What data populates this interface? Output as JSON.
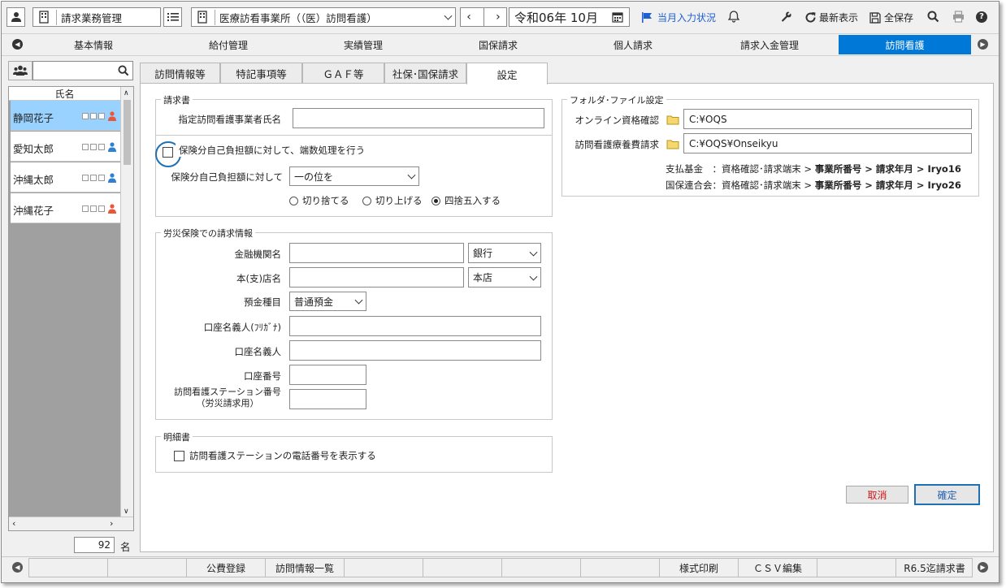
{
  "header": {
    "app_title": "請求業務管理",
    "facility": "医療訪看事業所（（医）訪問看護）",
    "date": "令和06年 10月",
    "monthly_status": "当月入力状況",
    "refresh": "最新表示",
    "save_all": "全保存"
  },
  "nav_tabs": [
    "基本情報",
    "給付管理",
    "実績管理",
    "国保請求",
    "個人請求",
    "請求入金管理",
    "訪問看護"
  ],
  "sub_tabs": [
    "訪問情報等",
    "特記事項等",
    "ＧＡＦ等",
    "社保･国保請求",
    "設定"
  ],
  "patients": {
    "header": "氏名",
    "count": "92",
    "count_unit": "名",
    "items": [
      {
        "name": "静岡花子",
        "gender": "female",
        "selected": true
      },
      {
        "name": "愛知太郎",
        "gender": "male",
        "selected": false
      },
      {
        "name": "沖縄太郎",
        "gender": "male",
        "selected": false
      },
      {
        "name": "沖縄花子",
        "gender": "female",
        "selected": false
      }
    ]
  },
  "invoice": {
    "title": "請求書",
    "provider_name_label": "指定訪問看護事業者氏名",
    "provider_name_value": "",
    "rounding_checkbox_label": "保険分自己負担額に対して、端数処理を行う",
    "rounding_target_label": "保険分自己負担額に対して",
    "rounding_digit": "一の位を",
    "radio_truncate": "切り捨てる",
    "radio_roundup": "切り上げる",
    "radio_round": "四捨五入する"
  },
  "rosai": {
    "title": "労災保険での請求情報",
    "bank_label": "金融機関名",
    "bank_type": "銀行",
    "branch_label": "本(支)店名",
    "branch_type": "本店",
    "deposit_type_label": "預金種目",
    "deposit_type": "普通預金",
    "holder_kana_label": "口座名義人(ﾌﾘｶﾞﾅ)",
    "holder_label": "口座名義人",
    "account_no_label": "口座番号",
    "station_no_label_1": "訪問看護ステーション番号",
    "station_no_label_2": "（労災請求用）"
  },
  "statement": {
    "title": "明細書",
    "show_phone_label": "訪問看護ステーションの電話番号を表示する"
  },
  "folder": {
    "title": "フォルダ･ファイル設定",
    "online_label": "オンライン資格確認",
    "online_path": "C:¥OQS",
    "ryoyo_label": "訪問看護療養費請求",
    "ryoyo_path": "C:¥OQS¥Onseikyu",
    "note1_prefix": "支払基金　：資格確認･請求端末 > ",
    "note1_bold": "事業所番号 > 請求年月 > Iryo16",
    "note2_prefix": "国保連合会：資格確認･請求端末 > ",
    "note2_bold": "事業所番号 > 請求年月 > Iryo26"
  },
  "actions": {
    "cancel": "取消",
    "confirm": "確定"
  },
  "footer": [
    "",
    "",
    "公費登録",
    "訪問情報一覧",
    "",
    "",
    "",
    "",
    "様式印刷",
    "ＣＳＶ編集",
    "",
    "R6.5迄請求書"
  ],
  "colors": {
    "active_tab": "#0078d7",
    "focus_ring": "#1f6fb3",
    "selected_row": "#99d1ff",
    "female": "#e8573a",
    "male": "#2f80d1",
    "cancel_text": "#d11515",
    "confirm_text": "#1f5fb5",
    "status_flag": "#1f5fd1"
  }
}
